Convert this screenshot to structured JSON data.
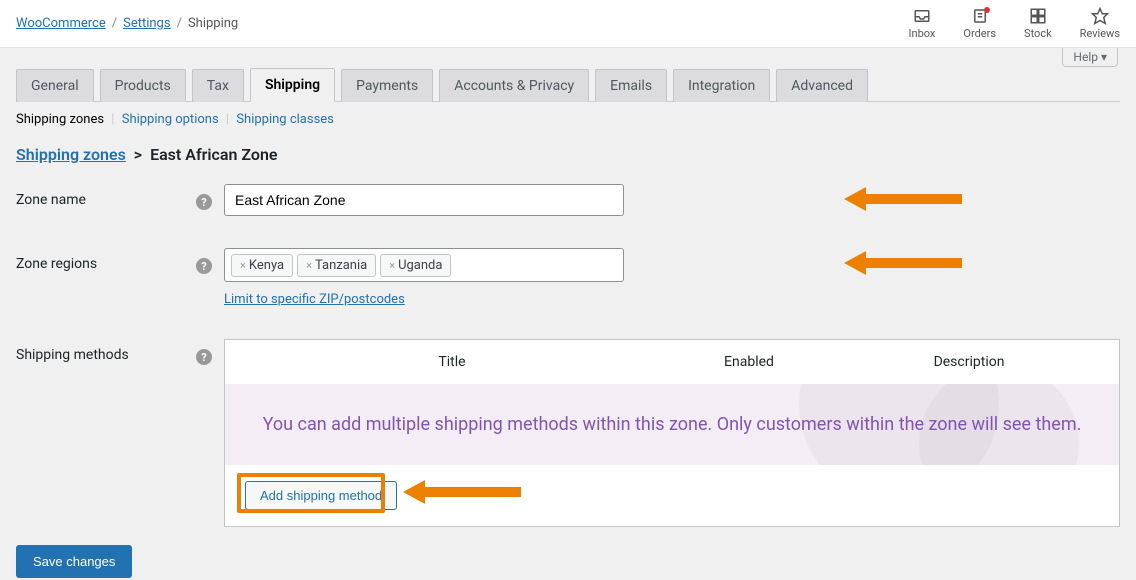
{
  "breadcrumb": {
    "root": "WooCommerce",
    "mid": "Settings",
    "leaf": "Shipping"
  },
  "topbar": {
    "inbox": "Inbox",
    "orders": "Orders",
    "stock": "Stock",
    "reviews": "Reviews"
  },
  "help": "Help",
  "tabs": [
    "General",
    "Products",
    "Tax",
    "Shipping",
    "Payments",
    "Accounts & Privacy",
    "Emails",
    "Integration",
    "Advanced"
  ],
  "active_tab": "Shipping",
  "subnav": {
    "zones": "Shipping zones",
    "options": "Shipping options",
    "classes": "Shipping classes"
  },
  "zone_breadcrumb": {
    "root": "Shipping zones",
    "name": "East African Zone"
  },
  "zone_name_label": "Zone name",
  "zone_name_value": "East African Zone",
  "zone_regions_label": "Zone regions",
  "zone_regions": [
    "Kenya",
    "Tanzania",
    "Uganda"
  ],
  "limit_link": "Limit to specific ZIP/postcodes",
  "methods_label": "Shipping methods",
  "methods_headers": {
    "title": "Title",
    "enabled": "Enabled",
    "description": "Description"
  },
  "methods_empty": "You can add multiple shipping methods within this zone. Only customers within the zone will see them.",
  "add_method": "Add shipping method",
  "save": "Save changes"
}
